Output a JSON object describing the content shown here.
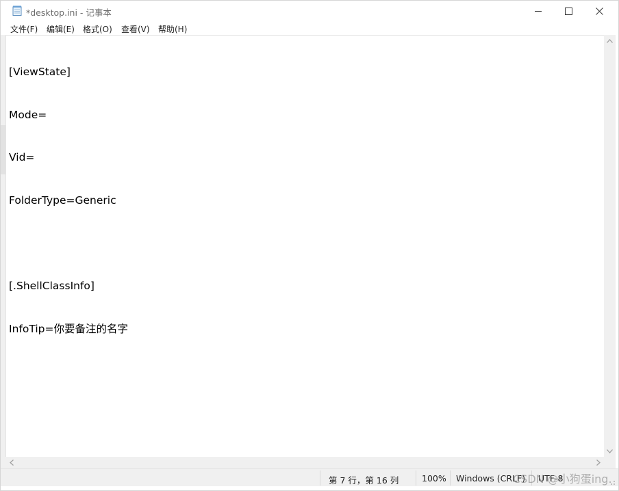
{
  "window": {
    "title": "*desktop.ini - 记事本",
    "buttons": {
      "minimize": "minimize-icon",
      "maximize": "maximize-icon",
      "close": "close-icon"
    }
  },
  "menu": {
    "items": [
      {
        "label": "文件(F)"
      },
      {
        "label": "编辑(E)"
      },
      {
        "label": "格式(O)"
      },
      {
        "label": "查看(V)"
      },
      {
        "label": "帮助(H)"
      }
    ]
  },
  "editor": {
    "lines": [
      "[ViewState]",
      "Mode=",
      "Vid=",
      "FolderType=Generic",
      "",
      "[.ShellClassInfo]",
      "InfoTip=你要备注的名字"
    ]
  },
  "status": {
    "position": "第 7 行，第 16 列",
    "zoom": "100%",
    "line_ending": "Windows (CRLF)",
    "encoding": "UTF-8"
  },
  "watermark": "CSDN @小狗蛋ing.",
  "colors": {
    "chrome": "#f0f0f0",
    "editor_bg": "#ffffff",
    "text": "#000000",
    "title_text": "#6b6b6b"
  }
}
